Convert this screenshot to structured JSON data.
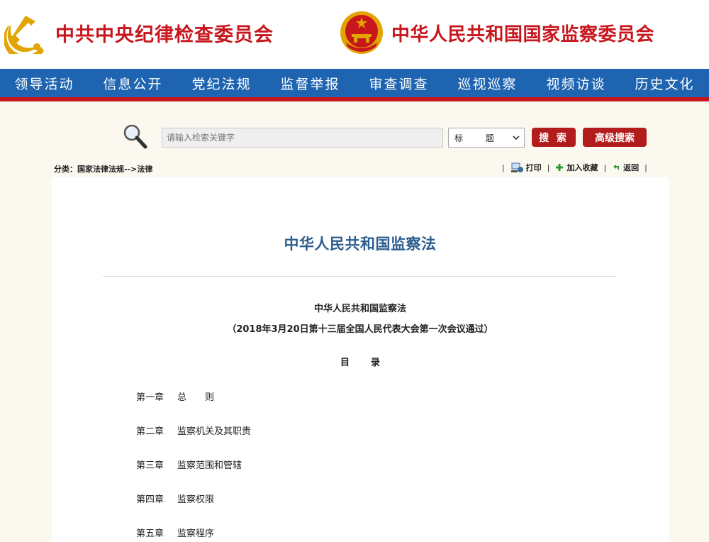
{
  "header": {
    "left_title": "中共中央纪律检查委员会",
    "right_title": "中华人民共和国国家监察委员会",
    "colors": {
      "red": "#c8161d",
      "gold": "#e2a400",
      "nav_blue": "#1e64b0"
    }
  },
  "nav": {
    "items": [
      {
        "label": "领导活动"
      },
      {
        "label": "信息公开"
      },
      {
        "label": "党纪法规"
      },
      {
        "label": "监督举报"
      },
      {
        "label": "审查调查"
      },
      {
        "label": "巡视巡察"
      },
      {
        "label": "视频访谈"
      },
      {
        "label": "历史文化"
      }
    ]
  },
  "search": {
    "placeholder": "请输入检索关键字",
    "scope_selected": "标 题",
    "search_label": "搜 索",
    "advanced_label": "高级搜索",
    "icon": "magnifier-icon"
  },
  "breadcrumb": {
    "text": "分类：国家法律法规-->法律"
  },
  "tools": {
    "print_label": "打印",
    "favorite_label": "加入收藏",
    "back_label": "返回"
  },
  "article": {
    "title": "中华人民共和国监察法",
    "subtitle": "中华人民共和国监察法",
    "note": "（2018年3月20日第十三届全国人民代表大会第一次会议通过）",
    "toc_heading": "目录",
    "toc": [
      {
        "num": "第一章",
        "name": "总　　则"
      },
      {
        "num": "第二章",
        "name": "监察机关及其职责"
      },
      {
        "num": "第三章",
        "name": "监察范围和管辖"
      },
      {
        "num": "第四章",
        "name": "监察权限"
      },
      {
        "num": "第五章",
        "name": "监察程序"
      }
    ]
  }
}
